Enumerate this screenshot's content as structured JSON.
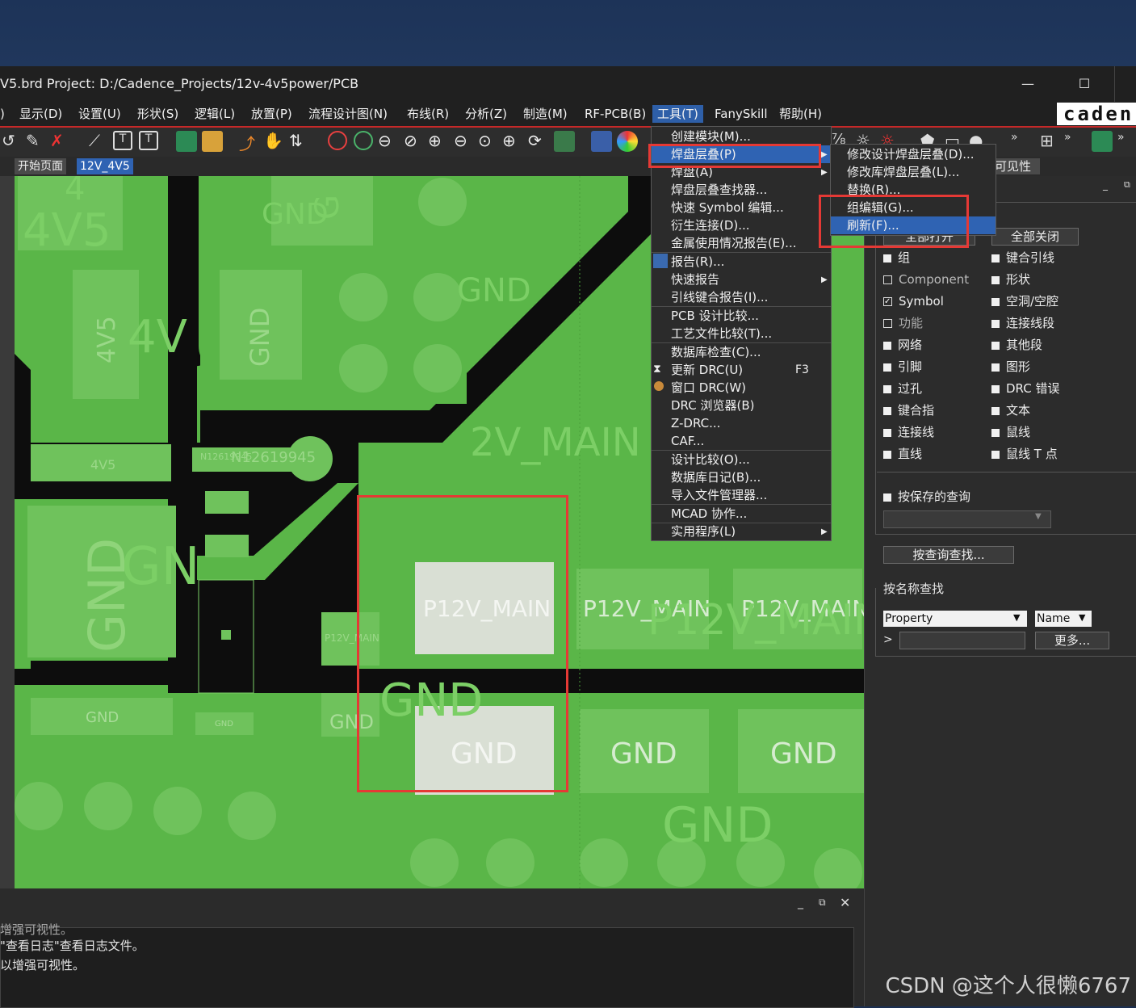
{
  "window": {
    "title": "V5.brd  Project: D:/Cadence_Projects/12v-4v5power/PCB",
    "minimize": "—",
    "maximize": "☐",
    "brand": "caden"
  },
  "menubar": {
    "items": [
      "显示(D)",
      "设置(U)",
      "形状(S)",
      "逻辑(L)",
      "放置(P)",
      "流程设计图(N)",
      "布线(R)",
      "分析(Z)",
      "制造(M)",
      "RF-PCB(B)",
      "工具(T)",
      "FanySkill",
      "帮助(H)"
    ]
  },
  "tabs": {
    "start": "开始页面",
    "design": "12V_4V5"
  },
  "tools_menu": {
    "items": [
      "创建模块(M)...",
      "焊盘层叠(P)",
      "焊盘(A)",
      "焊盘层叠查找器...",
      "快速 Symbol 编辑...",
      "衍生连接(D)...",
      "金属使用情况报告(E)...",
      "报告(R)...",
      "快速报告",
      "引线键合报告(I)...",
      "PCB 设计比较...",
      "工艺文件比较(T)...",
      "数据库检查(C)...",
      "更新 DRC(U)",
      "窗口 DRC(W)",
      "DRC 浏览器(B)",
      "Z-DRC...",
      "CAF...",
      "设计比较(O)...",
      "数据库日记(B)...",
      "导入文件管理器...",
      "MCAD 协作...",
      "实用程序(L)"
    ],
    "shortcut_update_drc": "F3"
  },
  "padstack_submenu": {
    "items": [
      "修改设计焊盘层叠(D)...",
      "修改库焊盘层叠(L)...",
      "替换(R)...",
      "组编辑(G)...",
      "刷新(F)..."
    ]
  },
  "panel": {
    "title": "可见性",
    "open_all": "全部打开",
    "close_all": "全部关闭",
    "left_col": [
      {
        "label": "组",
        "checked": true
      },
      {
        "label": "Component",
        "checked": false
      },
      {
        "label": "Symbol",
        "checked": true
      },
      {
        "label": "功能",
        "checked": false
      },
      {
        "label": "网络",
        "checked": true
      },
      {
        "label": "引脚",
        "checked": true
      },
      {
        "label": "过孔",
        "checked": true
      },
      {
        "label": "键合指",
        "checked": true
      },
      {
        "label": "连接线",
        "checked": true
      },
      {
        "label": "直线",
        "checked": true
      }
    ],
    "right_col": [
      {
        "label": "键合引线",
        "checked": true
      },
      {
        "label": "形状",
        "checked": true
      },
      {
        "label": "空洞/空腔",
        "checked": true
      },
      {
        "label": "连接线段",
        "checked": true
      },
      {
        "label": "其他段",
        "checked": true
      },
      {
        "label": "图形",
        "checked": true
      },
      {
        "label": "DRC 错误",
        "checked": true
      },
      {
        "label": "文本",
        "checked": true
      },
      {
        "label": "鼠线",
        "checked": true
      },
      {
        "label": "鼠线 T 点",
        "checked": true
      }
    ],
    "saved_query": "按保存的查询",
    "find_by_query": "按查询查找...",
    "find_by_name": "按名称查找",
    "property_select": "Property",
    "name_select": "Name",
    "more": "更多...",
    "prompt": ">"
  },
  "canvas": {
    "labels": {
      "n4v5_big": "4V5",
      "n4v5_vert": "4V5",
      "n4v5_small": "4V5",
      "gnd_top": "GND",
      "gnd_top2": "GND",
      "gnd_vert": "GND",
      "gnd_mid": "GND",
      "gnd_left_big": "GND",
      "gnd_left_small": "GND",
      "gnd_tiny": "GND",
      "gnd_bot1": "GND",
      "gnd_bot2": "GND",
      "gnd_bot3": "GND",
      "gnd_bot4": "GND",
      "gnd_bottom_big": "GND",
      "gnd_overlap": "GND",
      "p12_main_big": "2V_MAIN",
      "p12_pad1": "P12V_MAIN",
      "p12_pad2": "P12V_MAIN",
      "p12_pad3": "P12V_MAIN",
      "p12_ghost": "P12V_MAIN",
      "p12_small": "P12V_MAIN",
      "net_n": "N12619945",
      "net_n_small": "N12619945",
      "gn": "GN",
      "g_top": "G",
      "four_v": "4V",
      "four_top": "4"
    }
  },
  "console": {
    "line1": "增强可视性。",
    "line2": "\"查看日志\"查看日志文件。",
    "line3": "以增强可视性。"
  },
  "watermark": "CSDN @这个人很懒6767"
}
